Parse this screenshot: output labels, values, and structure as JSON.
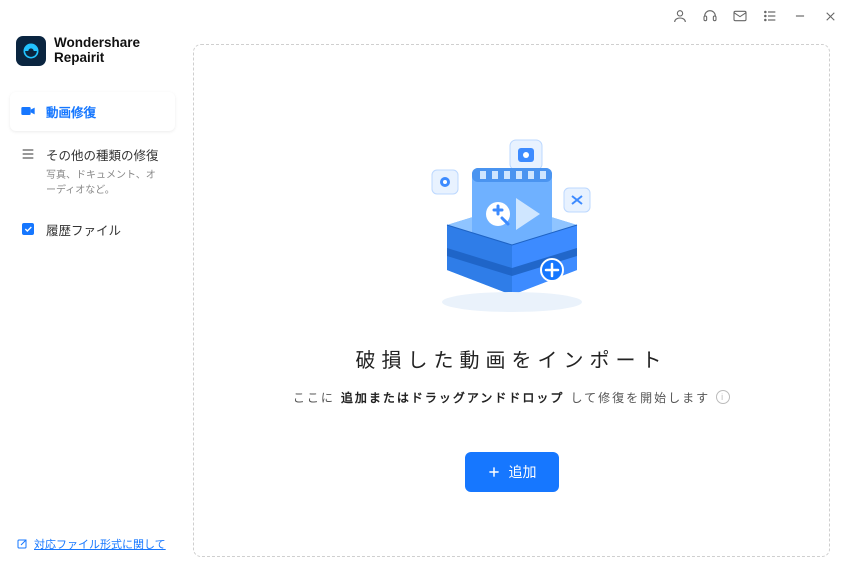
{
  "app": {
    "brand_line1": "Wondershare",
    "brand_line2": "Repairit"
  },
  "titlebar": {
    "icons": [
      "account",
      "support",
      "mail",
      "menu",
      "minimize",
      "close"
    ]
  },
  "sidebar": {
    "items": [
      {
        "label": "動画修復",
        "sub": "",
        "icon": "video"
      },
      {
        "label": "その他の種類の修復",
        "sub": "写真、ドキュメント、オーディオなど。",
        "icon": "list"
      },
      {
        "label": "履歴ファイル",
        "sub": "",
        "icon": "history-check"
      }
    ],
    "footer_link": "対応ファイル形式に関して"
  },
  "main": {
    "headline": "破損した動画をインポート",
    "sub_prefix": "ここに",
    "sub_bold": "追加またはドラッグアンドドロップ",
    "sub_suffix": "して修復を開始します",
    "add_button": "追加"
  },
  "colors": {
    "accent": "#1677ff"
  }
}
